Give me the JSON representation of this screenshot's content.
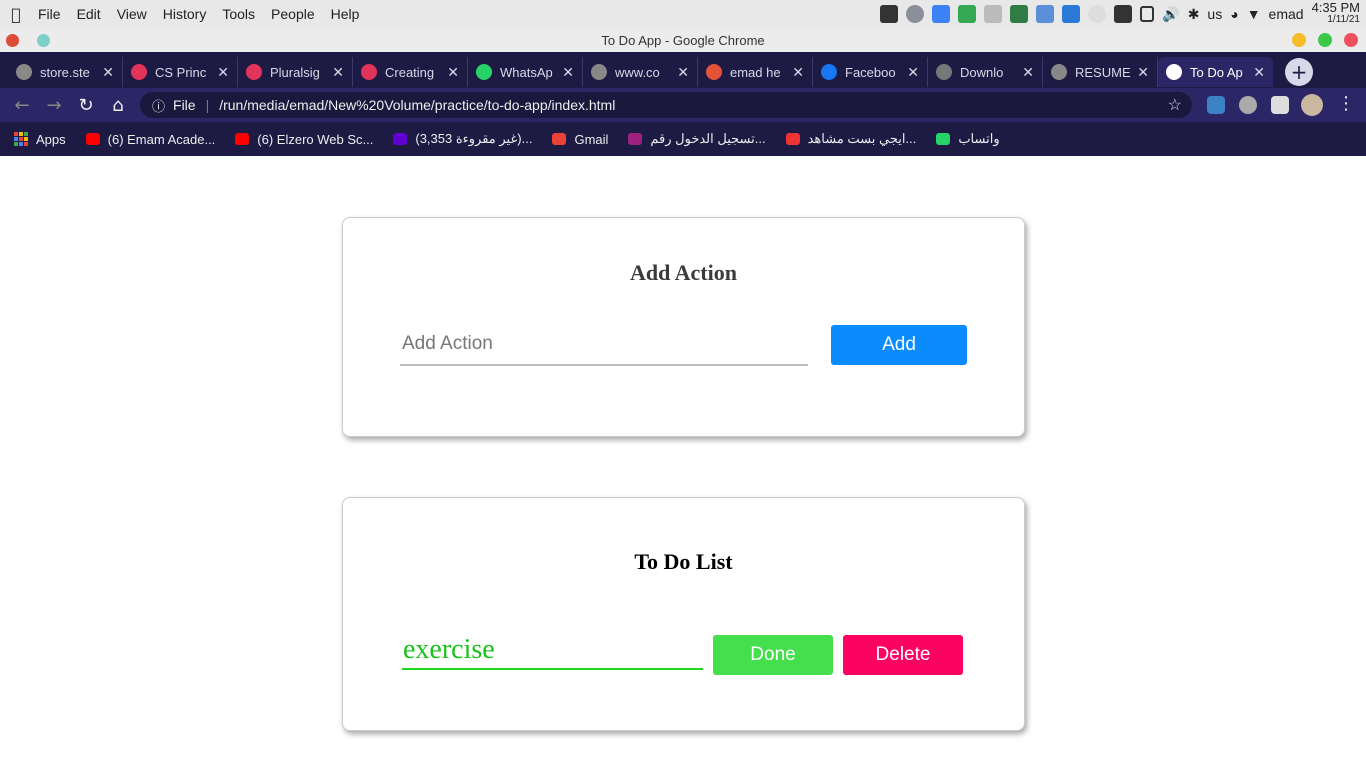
{
  "menubar": {
    "items": [
      "File",
      "Edit",
      "View",
      "History",
      "Tools",
      "People",
      "Help"
    ],
    "user": "emad",
    "lang": "us",
    "time": "4:35 PM",
    "date": "1/11/21"
  },
  "window": {
    "title": "To Do App - Google Chrome"
  },
  "tabs": [
    {
      "label": "store.ste",
      "color": "#888888"
    },
    {
      "label": "CS Princ",
      "color": "#e2335a"
    },
    {
      "label": "Pluralsig",
      "color": "#e2335a"
    },
    {
      "label": "Creating",
      "color": "#e2335a"
    },
    {
      "label": "WhatsAp",
      "color": "#25d366"
    },
    {
      "label": "www.co",
      "color": "#888888"
    },
    {
      "label": "emad he",
      "color": "#e2533a"
    },
    {
      "label": "Faceboo",
      "color": "#1877f2"
    },
    {
      "label": "Downlo",
      "color": "#777777"
    },
    {
      "label": "RESUME",
      "color": "#888888"
    },
    {
      "label": "To Do Ap",
      "color": "#ffffff",
      "active": true
    }
  ],
  "omnibox": {
    "scheme": "File",
    "url": "/run/media/emad/New%20Volume/practice/to-do-app/index.html"
  },
  "bookmarks": [
    {
      "label": "Apps"
    },
    {
      "label": "(6) Emam Acade...",
      "color": "#ff0000"
    },
    {
      "label": "(6) Elzero Web Sc...",
      "color": "#ff0000"
    },
    {
      "label": "(3,353 غير مقروءة)...",
      "color": "#6001d2"
    },
    {
      "label": "Gmail",
      "color": "#ea4335"
    },
    {
      "label": "تسجيل الدخول رقم...",
      "color": "#a02080"
    },
    {
      "label": "ايجي بست مشاهد...",
      "color": "#e33"
    },
    {
      "label": "واتساب",
      "color": "#25d366"
    }
  ],
  "colors": {
    "add_button": "#0a8cff",
    "done_button": "#45df4d",
    "delete_button": "#fc0363",
    "todo_text": "#19c219"
  },
  "add_card": {
    "title": "Add Action",
    "input_placeholder": "Add Action",
    "input_value": "",
    "add_label": "Add"
  },
  "list_card": {
    "title": "To Do List",
    "items": [
      {
        "text": "exercise",
        "done_label": "Done",
        "delete_label": "Delete"
      }
    ]
  }
}
